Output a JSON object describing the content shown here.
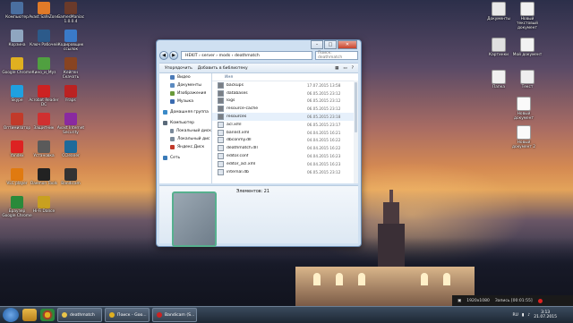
{
  "desktop_icons_left": [
    {
      "label": "Компьютер",
      "color": "#4a6fa0"
    },
    {
      "label": "Avast SafeZone",
      "color": "#e07a28"
    },
    {
      "label": "GamesManiac 1.0.0.4",
      "color": "#6a3a2a"
    },
    {
      "label": "Корзина",
      "color": "#8fa6c0"
    },
    {
      "label": "Ключ Рабочей",
      "color": "#2c5a8a"
    },
    {
      "label": "Кодировщик ссылок",
      "color": "#3a7ac8"
    },
    {
      "label": "Google Chrome",
      "color": "#e0b020"
    },
    {
      "label": "Кино_и_Муз",
      "color": "#50a040"
    },
    {
      "label": "Кейген Скачать",
      "color": "#884422"
    },
    {
      "label": "Skype",
      "color": "#1fa0e0"
    },
    {
      "label": "Acrobat Reader DC",
      "color": "#c22"
    },
    {
      "label": "Fraps",
      "color": "#b22"
    },
    {
      "label": "Оптимизатор",
      "color": "#c23a2a"
    },
    {
      "label": "Защитник",
      "color": "#d03030"
    },
    {
      "label": "Avast Internet Security",
      "color": "#8a2aa0"
    },
    {
      "label": "Yandex",
      "color": "#d22"
    },
    {
      "label": "Установка",
      "color": "#5a5a5a"
    },
    {
      "label": "CCleaner",
      "color": "#1e6a9a"
    },
    {
      "label": "VLC player",
      "color": "#e07a10"
    },
    {
      "label": "Daemon Tools",
      "color": "#222"
    },
    {
      "label": "Bandicam",
      "color": "#333"
    },
    {
      "label": "Браузер Google Chrome",
      "color": "#2a8a3a"
    },
    {
      "label": "Hi-Fi Dance",
      "color": "#c8a020"
    }
  ],
  "desktop_icons_right": [
    {
      "label": "Документы",
      "color": "#e8e8e8"
    },
    {
      "label": "Новый текстовый документ",
      "color": "#f0f0f0"
    },
    {
      "label": "Картинки",
      "color": "#e0e0e0"
    },
    {
      "label": "Мой документ",
      "color": "#f2f2f2"
    },
    {
      "label": "Папка",
      "color": "#f0f0f0"
    },
    {
      "label": "Текст",
      "color": "#eee"
    },
    {
      "label": "Новый документ",
      "color": "#fafafa"
    },
    {
      "label": "Новый документ 2",
      "color": "#fafafa"
    }
  ],
  "explorer": {
    "breadcrumb": [
      "HEKIT",
      "server",
      "mods",
      "deathmatch"
    ],
    "search_placeholder": "Поиск: deathmatch",
    "toolbar": {
      "organize": "Упорядочить",
      "add_library": "Добавить в библиотеку"
    },
    "nav_items": [
      {
        "label": "Видео",
        "sub": true
      },
      {
        "label": "Документы",
        "sub": true
      },
      {
        "label": "Изображения",
        "sub": true
      },
      {
        "label": "Музыка",
        "sub": true
      },
      {
        "label": "Домашняя группа",
        "sub": false
      },
      {
        "label": "Компьютер",
        "sub": false
      },
      {
        "label": "Локальный диск",
        "sub": true
      },
      {
        "label": "Локальный дис",
        "sub": true
      },
      {
        "label": "Яндекс.Диск",
        "sub": true
      },
      {
        "label": "Сеть",
        "sub": false
      }
    ],
    "column_name": "Имя",
    "files": [
      {
        "name": "backups",
        "date": "17.07.2015 13:58",
        "type": "folder"
      },
      {
        "name": "databases",
        "date": "06.05.2015 23:12",
        "type": "folder"
      },
      {
        "name": "logs",
        "date": "06.05.2015 23:12",
        "type": "folder"
      },
      {
        "name": "resource-cache",
        "date": "06.05.2015 23:12",
        "type": "folder"
      },
      {
        "name": "resources",
        "date": "06.05.2015 23:18",
        "type": "folder"
      },
      {
        "name": "acl.xml",
        "date": "06.05.2015 23:17",
        "type": "file"
      },
      {
        "name": "banlist.xml",
        "date": "04.04.2015 16:21",
        "type": "file"
      },
      {
        "name": "dbconmy.dll",
        "date": "04.04.2015 16:22",
        "type": "file"
      },
      {
        "name": "deathmatch.dll",
        "date": "04.04.2015 16:22",
        "type": "file"
      },
      {
        "name": "editor.conf",
        "date": "04.04.2015 16:23",
        "type": "file"
      },
      {
        "name": "editor_acl.xml",
        "date": "04.04.2015 16:23",
        "type": "file"
      },
      {
        "name": "internal.db",
        "date": "06.05.2015 23:12",
        "type": "file"
      }
    ],
    "item_count": "Элементов: 21"
  },
  "recording": {
    "resolution": "1920x1080",
    "status": "Запись [00:01:55]"
  },
  "taskbar": {
    "tasks": [
      {
        "label": "deathmatch",
        "color": "#e8c44a"
      },
      {
        "label": "Поиск - Goo...",
        "color": "#e0b020"
      },
      {
        "label": "Bandicam (S...",
        "color": "#c22"
      }
    ],
    "lang": "RU",
    "time": "3:13",
    "date": "21.07.2015"
  }
}
